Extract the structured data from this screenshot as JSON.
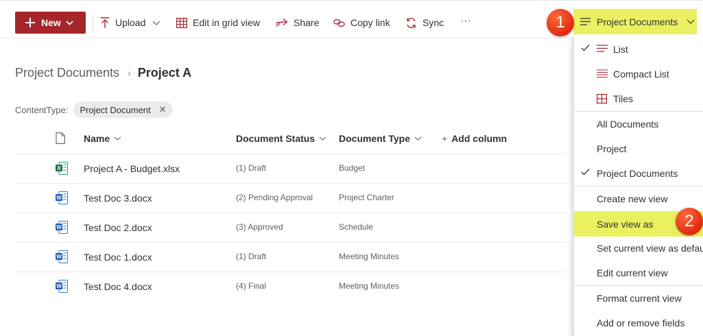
{
  "toolbar": {
    "new_label": "New",
    "upload_label": "Upload",
    "grid_label": "Edit in grid view",
    "share_label": "Share",
    "copy_link_label": "Copy link",
    "sync_label": "Sync",
    "more_label": "···",
    "view_switcher_label": "Project Documents"
  },
  "callouts": {
    "one": "1",
    "two": "2"
  },
  "breadcrumb": {
    "root": "Project Documents",
    "separator": "›",
    "current": "Project A"
  },
  "filter": {
    "label": "ContentType:",
    "value": "Project Document",
    "clear": "✕"
  },
  "table": {
    "headers": {
      "name": "Name",
      "status": "Document Status",
      "type": "Document Type",
      "add": "Add column"
    },
    "rows": [
      {
        "name": "Project A - Budget.xlsx",
        "status": "(1) Draft",
        "type": "Budget",
        "icon": "excel-icon"
      },
      {
        "name": "Test Doc 3.docx",
        "status": "(2) Pending Approval",
        "type": "Project Charter",
        "icon": "word-icon"
      },
      {
        "name": "Test Doc 2.docx",
        "status": "(3) Approved",
        "type": "Schedule",
        "icon": "word-icon"
      },
      {
        "name": "Test Doc 1.docx",
        "status": "(1) Draft",
        "type": "Meeting Minutes",
        "icon": "word-icon"
      },
      {
        "name": "Test Doc 4.docx",
        "status": "(4) Final",
        "type": "Meeting Minutes",
        "icon": "word-icon"
      }
    ]
  },
  "view_menu": {
    "layouts": [
      {
        "label": "List",
        "checked": true
      },
      {
        "label": "Compact List",
        "checked": false
      },
      {
        "label": "Tiles",
        "checked": false
      }
    ],
    "views": [
      {
        "label": "All Documents",
        "checked": false
      },
      {
        "label": "Project",
        "checked": false
      },
      {
        "label": "Project Documents",
        "checked": true
      }
    ],
    "actions": [
      {
        "label": "Create new view"
      },
      {
        "label": "Save view as",
        "highlighted": true
      },
      {
        "label": "Set current view as default"
      },
      {
        "label": "Edit current view"
      }
    ],
    "footer": [
      {
        "label": "Format current view"
      },
      {
        "label": "Add or remove fields"
      }
    ]
  },
  "colors": {
    "accent": "#a4262c",
    "highlight": "#ebf061",
    "badge": "#e8361a",
    "excel": "#217346",
    "word": "#185abd"
  }
}
